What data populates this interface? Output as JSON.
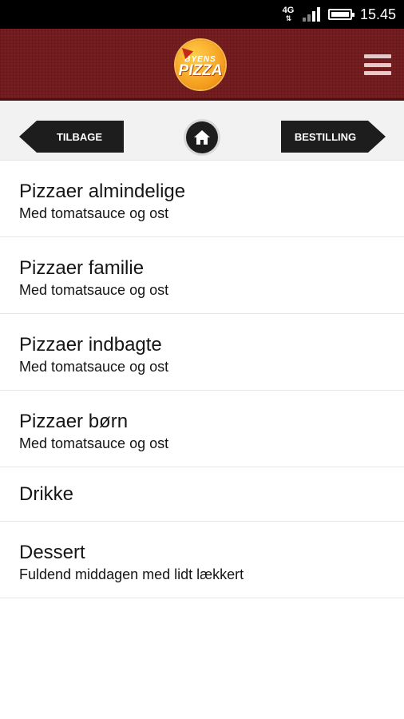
{
  "status_bar": {
    "network": "4G",
    "time": "15.45",
    "network_icon": "network-4g-icon",
    "signal_icon": "signal-icon",
    "battery_icon": "battery-icon"
  },
  "header": {
    "logo": {
      "line1": "BYENS",
      "line2": "PIZZA"
    },
    "menu_icon": "hamburger-menu-icon",
    "colors": {
      "background": "#7a1d20",
      "logo_orange": "#f49a1b"
    }
  },
  "nav": {
    "back_label": "TILBAGE",
    "home_icon": "home-icon",
    "order_label": "BESTILLING"
  },
  "menu_items": [
    {
      "title": "Pizzaer almindelige",
      "subtitle": "Med tomatsauce og ost"
    },
    {
      "title": "Pizzaer familie",
      "subtitle": "Med tomatsauce og ost"
    },
    {
      "title": "Pizzaer indbagte",
      "subtitle": "Med tomatsauce og ost"
    },
    {
      "title": "Pizzaer børn",
      "subtitle": "Med tomatsauce og ost"
    },
    {
      "title": "Drikke"
    },
    {
      "title": "Dessert",
      "subtitle": "Fuldend middagen med lidt lækkert"
    }
  ]
}
